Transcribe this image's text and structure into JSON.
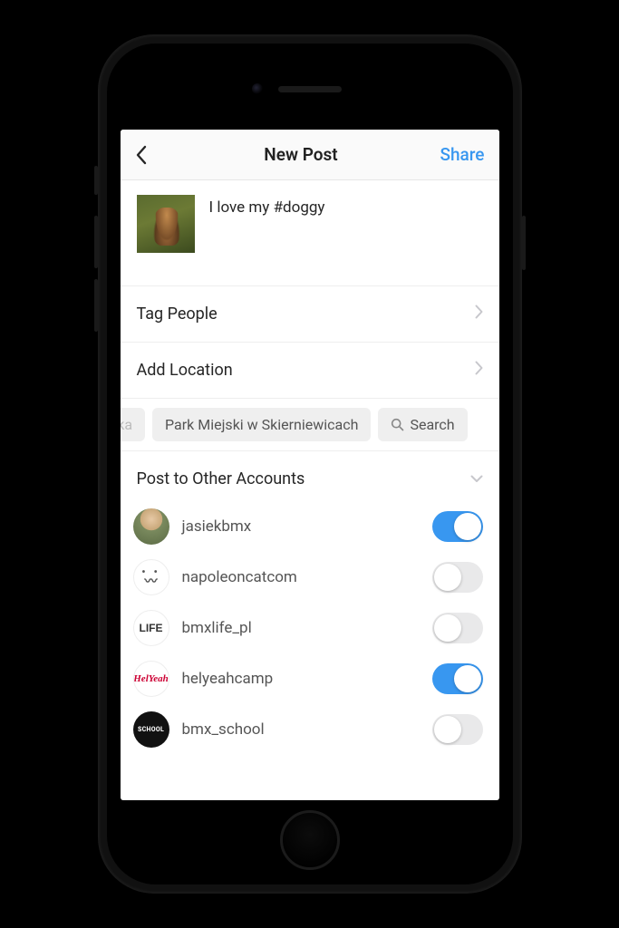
{
  "nav": {
    "title": "New Post",
    "share": "Share"
  },
  "caption": {
    "text": "I love my #doggy"
  },
  "rows": {
    "tag_people": "Tag People",
    "add_location": "Add Location"
  },
  "location_chips": {
    "partial": "awka",
    "full": "Park Miejski w Skierniewicach",
    "search": "Search"
  },
  "section": {
    "post_other": "Post to Other Accounts"
  },
  "accounts": [
    {
      "name": "jasiekbmx",
      "on": true
    },
    {
      "name": "napoleoncatcom",
      "on": false
    },
    {
      "name": "bmxlife_pl",
      "on": false
    },
    {
      "name": "helyeahcamp",
      "on": true
    },
    {
      "name": "bmx_school",
      "on": false
    }
  ],
  "avatar_labels": {
    "a2_top": "• •",
    "a2_bot": "〰",
    "a3": "LIFE",
    "a4": "HelYeah",
    "a5": "SCHOOL"
  }
}
